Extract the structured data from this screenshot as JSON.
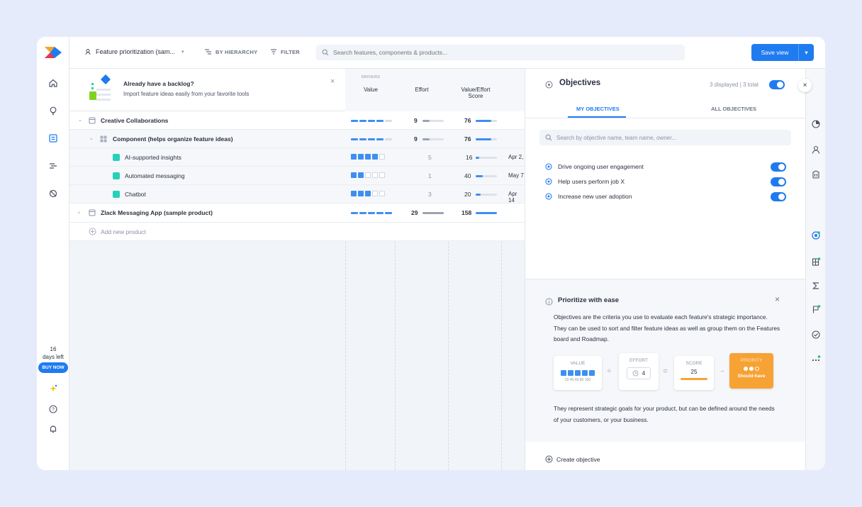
{
  "toolbar": {
    "view_name": "Feature prioritization (sam...",
    "hierarchy": "BY HIERARCHY",
    "filter": "FILTER",
    "search_placeholder": "Search features, components & products...",
    "save_label": "Save view"
  },
  "rail": {
    "days_num": "16",
    "days_text": "days left",
    "buy": "BUY NOW"
  },
  "banner": {
    "title": "Already have a backlog?",
    "subtitle": "Import feature ideas easily from your favorite tools"
  },
  "columns": {
    "drivers": "DRIVERS",
    "value": "Value",
    "effort": "Effort",
    "score_line1": "Value/Effort",
    "score_line2": "Score"
  },
  "rows": [
    {
      "name": "Creative Collaborations",
      "effort": "9",
      "score": "76"
    },
    {
      "name": "Component (helps organize feature ideas)",
      "effort": "9",
      "score": "76"
    },
    {
      "name": "AI-supported insights",
      "effort": "5",
      "score": "16",
      "date": "Apr 2,",
      "value_level": 4
    },
    {
      "name": "Automated messaging",
      "effort": "1",
      "score": "40",
      "date": "May 7",
      "value_level": 2
    },
    {
      "name": "Chatbot",
      "effort": "3",
      "score": "20",
      "date": "Apr 14",
      "value_level": 3
    },
    {
      "name": "Zlack Messaging App (sample product)",
      "effort": "29",
      "score": "158"
    }
  ],
  "add_product": "Add new product",
  "panel": {
    "title": "Objectives",
    "count": "3 displayed | 3 total",
    "tab_my": "MY OBJECTIVES",
    "tab_all": "ALL OBJECTIVES",
    "search_placeholder": "Search by objective name, team name, owner...",
    "objectives": [
      "Drive ongoing user engagement",
      "Help users perform job X",
      "Increase new user adoption"
    ],
    "help_title": "Prioritize with ease",
    "help_p1": "Objectives are the criteria you use to evaluate each feature's strategic importance. They can be used to sort and filter feature ideas as well as group them on the Features board and Roadmap.",
    "help_p2": "They represent strategic goals for your product, but can be defined around the needs of your customers, or your business.",
    "card_value": "VALUE",
    "card_value_scale": "20 40 60 80 100",
    "card_effort": "EFFORT",
    "card_effort_num": "4",
    "card_score": "SCORE",
    "card_score_num": "25",
    "card_priority": "PRIORITY",
    "card_priority_label": "Should-have",
    "create": "Create objective"
  },
  "colors": {
    "accent": "#1f7bf0",
    "teal": "#27d1b9",
    "orange": "#f7a234"
  }
}
